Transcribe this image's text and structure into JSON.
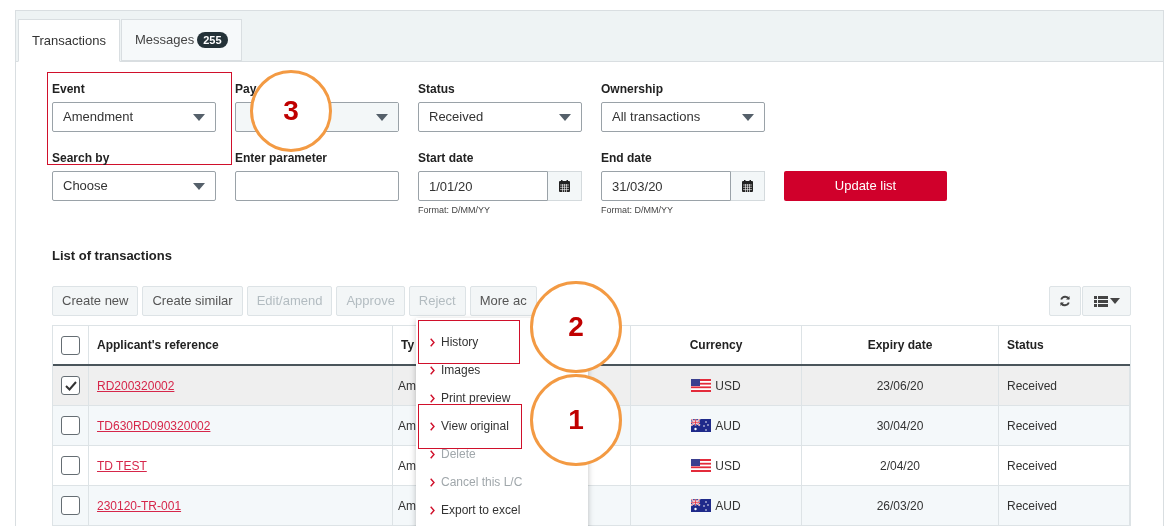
{
  "tabs": [
    {
      "label": "Transactions",
      "selected": true
    },
    {
      "label": "Messages",
      "badge": "255",
      "selected": false
    }
  ],
  "filters": [
    {
      "kind": "select",
      "label": "Event",
      "value": "Amendment",
      "disabled": false,
      "highlighted": true
    },
    {
      "kind": "select",
      "label": "Pay",
      "disabled": true,
      "highlighted": false
    },
    {
      "kind": "select",
      "label": "Status",
      "value": "Received",
      "disabled": false,
      "highlighted": false
    },
    {
      "kind": "select",
      "label": "Ownership",
      "value": "All transactions",
      "disabled": false,
      "highlighted": false
    },
    {
      "kind": "select",
      "label": "Search by",
      "value": "Choose",
      "disabled": false,
      "highlighted": false
    },
    {
      "kind": "text",
      "label": "Enter parameter",
      "disabled": false,
      "highlighted": false
    },
    {
      "kind": "date",
      "label": "Start date",
      "value": "1/01/20",
      "hint": "Format: D/MM/YY",
      "disabled": false,
      "highlighted": false
    },
    {
      "kind": "date",
      "label": "End date",
      "value": "31/03/20",
      "hint": "Format: D/MM/YY",
      "disabled": false,
      "highlighted": false
    }
  ],
  "update_button": "Update list",
  "list_title": "List of transactions",
  "actions": [
    {
      "label": "Create new",
      "disabled": false
    },
    {
      "label": "Create similar",
      "disabled": false
    },
    {
      "label": "Edit/amend",
      "disabled": true
    },
    {
      "label": "Approve",
      "disabled": true
    },
    {
      "label": "Reject",
      "disabled": true
    },
    {
      "label": "More ac",
      "disabled": false
    }
  ],
  "table": {
    "select_all_checked": false,
    "columns": [
      "Applicant's reference",
      "Ty",
      "Currency",
      "Expiry date",
      "Status"
    ],
    "rows": [
      {
        "checked": true,
        "reference": "RD200320002",
        "type": "Am",
        "kind": "us",
        "currency": "USD",
        "expiry": "23/06/20",
        "status": "Received"
      },
      {
        "checked": false,
        "reference": "TD630RD090320002",
        "type": "Am",
        "kind": "au",
        "currency": "AUD",
        "expiry": "30/04/20",
        "status": "Received"
      },
      {
        "checked": false,
        "reference": "TD TEST",
        "type": "Am",
        "kind": "us",
        "currency": "USD",
        "expiry": "2/04/20",
        "status": "Received"
      },
      {
        "checked": false,
        "reference": "230120-TR-001",
        "type": "Am",
        "kind": "au",
        "currency": "AUD",
        "expiry": "26/03/20",
        "status": "Received"
      }
    ]
  },
  "menu": [
    {
      "label": "History",
      "disabled": false,
      "highlighted": true
    },
    {
      "label": "Images",
      "disabled": false,
      "highlighted": false
    },
    {
      "label": "Print preview",
      "disabled": false,
      "highlighted": false
    },
    {
      "label": "View original",
      "disabled": false,
      "highlighted": true
    },
    {
      "label": "Delete",
      "disabled": true,
      "highlighted": false
    },
    {
      "label": "Cancel this L/C",
      "disabled": true,
      "highlighted": false
    },
    {
      "label": "Export to excel",
      "disabled": false,
      "highlighted": false
    }
  ],
  "annotations": [
    "3",
    "2",
    "1"
  ]
}
